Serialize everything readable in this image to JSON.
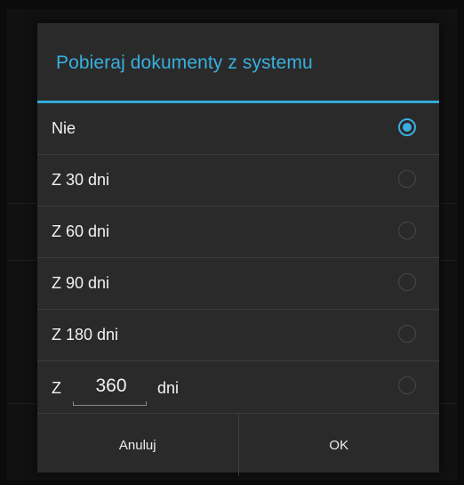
{
  "dialog": {
    "title": "Pobieraj dokumenty z systemu",
    "accent_color": "#33a8d8",
    "options": [
      {
        "label": "Nie",
        "checked": true
      },
      {
        "label": "Z 30 dni",
        "checked": false
      },
      {
        "label": "Z 60 dni",
        "checked": false
      },
      {
        "label": "Z 90 dni",
        "checked": false
      },
      {
        "label": "Z 180 dni",
        "checked": false
      }
    ],
    "custom": {
      "prefix": "Z",
      "value": "360",
      "suffix": "dni",
      "checked": false
    },
    "buttons": {
      "cancel": "Anuluj",
      "ok": "OK"
    }
  }
}
